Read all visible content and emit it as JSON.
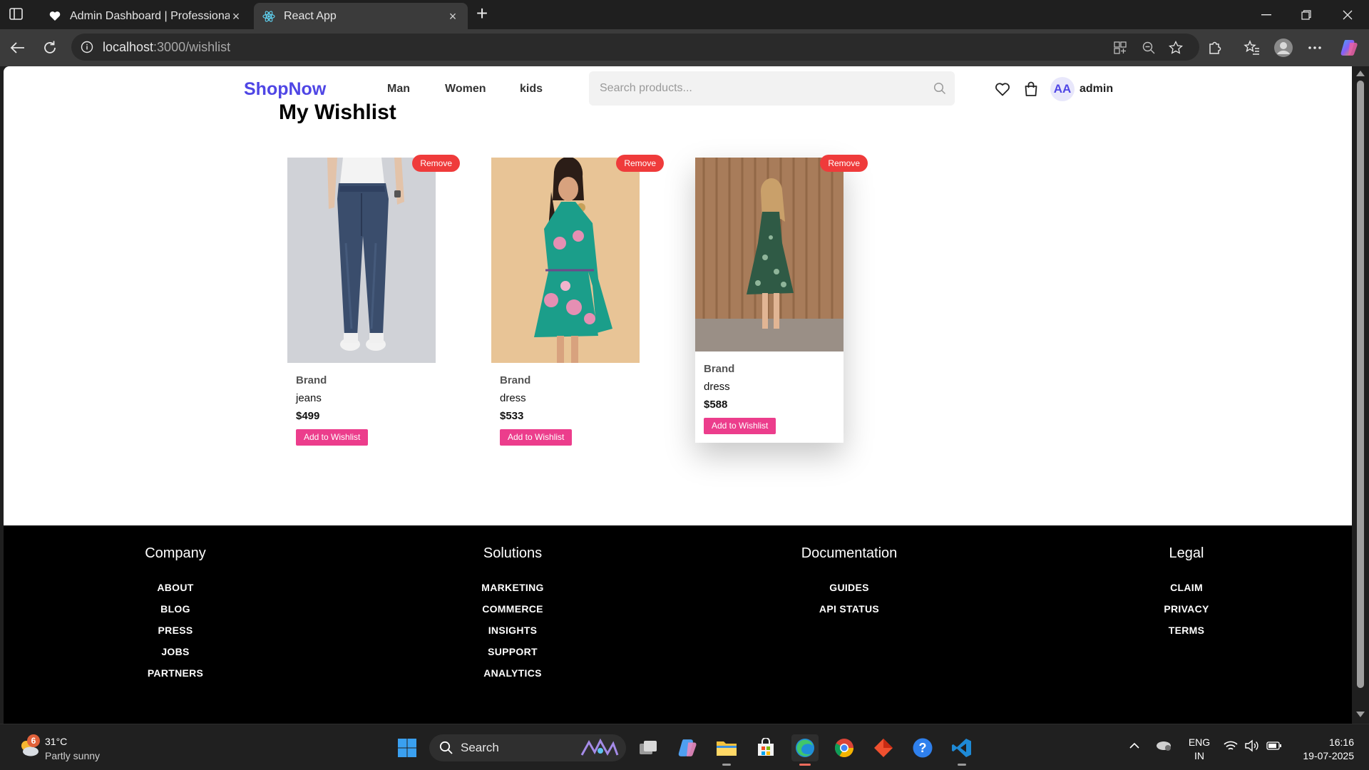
{
  "browser": {
    "tabs": [
      {
        "title": "Admin Dashboard | Professional M",
        "active": false
      },
      {
        "title": "React App",
        "active": true
      }
    ],
    "url_host": "localhost",
    "url_path": ":3000/wishlist"
  },
  "header": {
    "logo": "ShopNow",
    "nav": [
      "Man",
      "Women",
      "kids"
    ],
    "search_placeholder": "Search products...",
    "avatar_initials": "AA",
    "username": "admin"
  },
  "page": {
    "title": "My Wishlist",
    "remove_label": "Remove",
    "add_label": "Add to Wishlist",
    "products": [
      {
        "brand": "Brand",
        "name": "jeans",
        "price": "$499"
      },
      {
        "brand": "Brand",
        "name": "dress",
        "price": "$533"
      },
      {
        "brand": "Brand",
        "name": "dress",
        "price": "$588"
      }
    ]
  },
  "footer": {
    "columns": [
      {
        "heading": "Company",
        "links": [
          "ABOUT",
          "BLOG",
          "PRESS",
          "JOBS",
          "PARTNERS"
        ]
      },
      {
        "heading": "Solutions",
        "links": [
          "MARKETING",
          "COMMERCE",
          "INSIGHTS",
          "SUPPORT",
          "ANALYTICS"
        ]
      },
      {
        "heading": "Documentation",
        "links": [
          "GUIDES",
          "API STATUS"
        ]
      },
      {
        "heading": "Legal",
        "links": [
          "CLAIM",
          "PRIVACY",
          "TERMS"
        ]
      }
    ]
  },
  "taskbar": {
    "weather_badge": "6",
    "weather_temp": "31°C",
    "weather_desc": "Partly sunny",
    "search_label": "Search",
    "lang_line1": "ENG",
    "lang_line2": "IN",
    "time": "16:16",
    "date": "19-07-2025"
  },
  "colors": {
    "brand": "#4f46e5",
    "remove": "#ef3b3b",
    "add_button": "#ec3d8c",
    "footer_bg": "#000000"
  }
}
